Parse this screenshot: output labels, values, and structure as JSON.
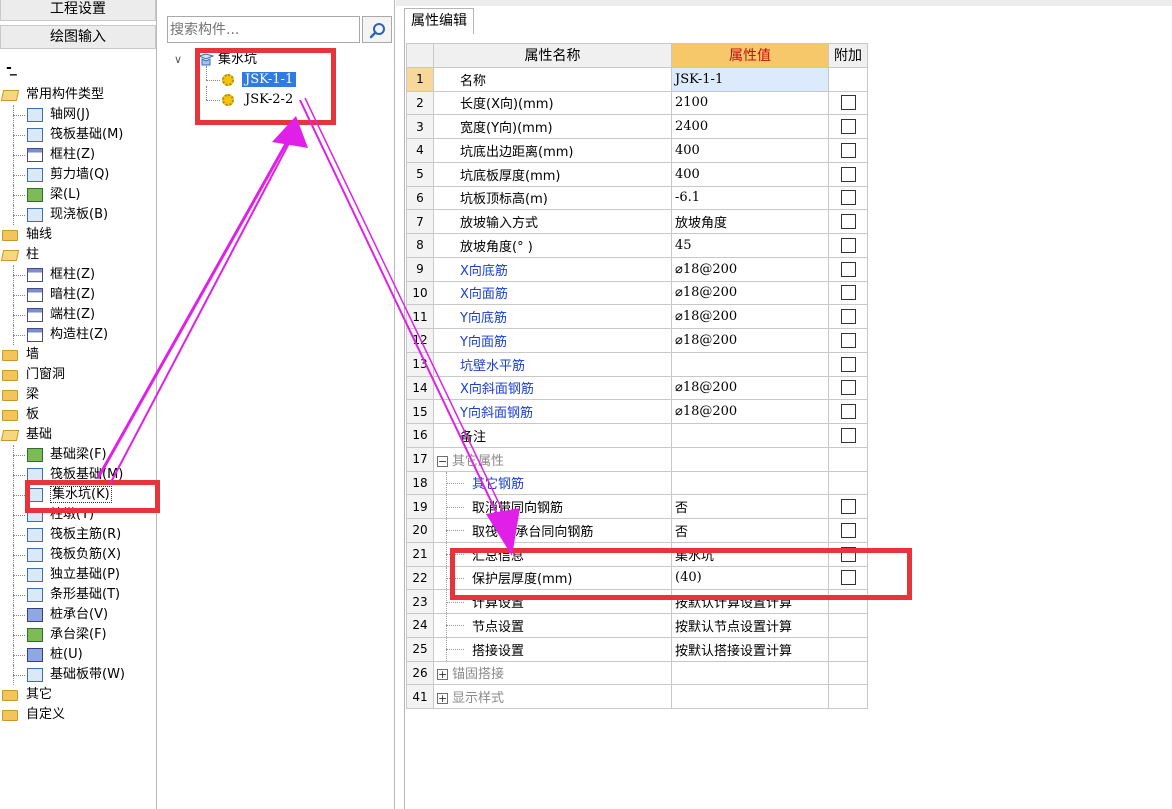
{
  "nav": {
    "tab_settings": "工程设置",
    "tab_drawing": "绘图输入",
    "collapse_symbol": "-",
    "tree": [
      {
        "label": "常用构件类型",
        "level": 0,
        "icon": "folder-open-icon"
      },
      {
        "label": "轴网(J)",
        "level": 1,
        "icon": "grid-axis-icon"
      },
      {
        "label": "筏板基础(M)",
        "level": 1,
        "icon": "raft-foundation-icon"
      },
      {
        "label": "框柱(Z)",
        "level": 1,
        "icon": "column-icon"
      },
      {
        "label": "剪力墙(Q)",
        "level": 1,
        "icon": "shear-wall-icon"
      },
      {
        "label": "梁(L)",
        "level": 1,
        "icon": "beam-icon"
      },
      {
        "label": "现浇板(B)",
        "level": 1,
        "icon": "slab-icon"
      },
      {
        "label": "轴线",
        "level": 0,
        "icon": "folder-icon"
      },
      {
        "label": "柱",
        "level": 0,
        "icon": "folder-open-icon"
      },
      {
        "label": "框柱(Z)",
        "level": 1,
        "icon": "column-icon"
      },
      {
        "label": "暗柱(Z)",
        "level": 1,
        "icon": "column-icon"
      },
      {
        "label": "端柱(Z)",
        "level": 1,
        "icon": "column-icon"
      },
      {
        "label": "构造柱(Z)",
        "level": 1,
        "icon": "constructional-column-icon"
      },
      {
        "label": "墙",
        "level": 0,
        "icon": "folder-icon"
      },
      {
        "label": "门窗洞",
        "level": 0,
        "icon": "folder-icon"
      },
      {
        "label": "梁",
        "level": 0,
        "icon": "folder-icon"
      },
      {
        "label": "板",
        "level": 0,
        "icon": "folder-icon"
      },
      {
        "label": "基础",
        "level": 0,
        "icon": "folder-open-icon"
      },
      {
        "label": "基础梁(F)",
        "level": 1,
        "icon": "foundation-beam-icon"
      },
      {
        "label": "筏板基础(M)",
        "level": 1,
        "icon": "raft-foundation-icon"
      },
      {
        "label": "集水坑(K)",
        "level": 1,
        "icon": "sump-pit-icon",
        "selected": true
      },
      {
        "label": "柱墩(Y)",
        "level": 1,
        "icon": "column-pier-icon"
      },
      {
        "label": "筏板主筋(R)",
        "level": 1,
        "icon": "raft-main-rebar-icon"
      },
      {
        "label": "筏板负筋(X)",
        "level": 1,
        "icon": "raft-negative-rebar-icon"
      },
      {
        "label": "独立基础(P)",
        "level": 1,
        "icon": "isolated-footing-icon"
      },
      {
        "label": "条形基础(T)",
        "level": 1,
        "icon": "strip-footing-icon"
      },
      {
        "label": "桩承台(V)",
        "level": 1,
        "icon": "pile-cap-icon"
      },
      {
        "label": "承台梁(F)",
        "level": 1,
        "icon": "cap-beam-icon"
      },
      {
        "label": "桩(U)",
        "level": 1,
        "icon": "pile-icon"
      },
      {
        "label": "基础板带(W)",
        "level": 1,
        "icon": "foundation-strip-icon"
      },
      {
        "label": "其它",
        "level": 0,
        "icon": "folder-icon"
      },
      {
        "label": "自定义",
        "level": 0,
        "icon": "folder-icon"
      }
    ]
  },
  "component_panel": {
    "search_placeholder": "搜索构件...",
    "root_label": "集水坑",
    "children": [
      {
        "label": "JSK-1-1",
        "selected": true
      },
      {
        "label": "JSK-2-2",
        "selected": false
      }
    ]
  },
  "properties": {
    "tab_label": "属性编辑",
    "headers": {
      "name": "属性名称",
      "value": "属性值",
      "extra": "附加"
    },
    "rows": [
      {
        "num": "1",
        "name": "名称",
        "value": "JSK-1-1",
        "style": "normal",
        "checkbox": false,
        "selected": true
      },
      {
        "num": "2",
        "name": "长度(X向)(mm)",
        "value": "2100",
        "style": "normal",
        "checkbox": true
      },
      {
        "num": "3",
        "name": "宽度(Y向)(mm)",
        "value": "2400",
        "style": "normal",
        "checkbox": true
      },
      {
        "num": "4",
        "name": "坑底出边距离(mm)",
        "value": "400",
        "style": "normal",
        "checkbox": true
      },
      {
        "num": "5",
        "name": "坑底板厚度(mm)",
        "value": "400",
        "style": "normal",
        "checkbox": true
      },
      {
        "num": "6",
        "name": "坑板顶标高(m)",
        "value": "-6.1",
        "style": "normal",
        "checkbox": true
      },
      {
        "num": "7",
        "name": "放坡输入方式",
        "value": "放坡角度",
        "style": "normal",
        "checkbox": true
      },
      {
        "num": "8",
        "name": "放坡角度(° )",
        "value": "45",
        "style": "normal",
        "checkbox": true
      },
      {
        "num": "9",
        "name": "X向底筋",
        "value": "⌀18@200",
        "style": "blue",
        "checkbox": true
      },
      {
        "num": "10",
        "name": "X向面筋",
        "value": "⌀18@200",
        "style": "blue",
        "checkbox": true
      },
      {
        "num": "11",
        "name": "Y向底筋",
        "value": "⌀18@200",
        "style": "blue",
        "checkbox": true
      },
      {
        "num": "12",
        "name": "Y向面筋",
        "value": "⌀18@200",
        "style": "blue",
        "checkbox": true
      },
      {
        "num": "13",
        "name": "坑壁水平筋",
        "value": "",
        "style": "blue",
        "checkbox": true
      },
      {
        "num": "14",
        "name": "X向斜面钢筋",
        "value": "⌀18@200",
        "style": "blue",
        "checkbox": true
      },
      {
        "num": "15",
        "name": "Y向斜面钢筋",
        "value": "⌀18@200",
        "style": "blue",
        "checkbox": true
      },
      {
        "num": "16",
        "name": "备注",
        "value": "",
        "style": "normal",
        "checkbox": true
      },
      {
        "num": "17",
        "name": "其它属性",
        "value": "",
        "style": "group",
        "checkbox": false,
        "toggle": "−"
      },
      {
        "num": "18",
        "name": "其它钢筋",
        "value": "",
        "style": "blue-sub",
        "checkbox": false
      },
      {
        "num": "19",
        "name": "取消带同向钢筋",
        "value": "否",
        "style": "sub",
        "checkbox": true
      },
      {
        "num": "20",
        "name": "取筏板/承台同向钢筋",
        "value": "否",
        "style": "sub",
        "checkbox": true
      },
      {
        "num": "21",
        "name": "汇总信息",
        "value": "集水坑",
        "style": "sub",
        "checkbox": true
      },
      {
        "num": "22",
        "name": "保护层厚度(mm)",
        "value": "(40)",
        "style": "sub",
        "checkbox": true
      },
      {
        "num": "23",
        "name": "计算设置",
        "value": "按默认计算设置计算",
        "style": "sub",
        "checkbox": false
      },
      {
        "num": "24",
        "name": "节点设置",
        "value": "按默认节点设置计算",
        "style": "sub",
        "checkbox": false
      },
      {
        "num": "25",
        "name": "搭接设置",
        "value": "按默认搭接设置计算",
        "style": "sub",
        "checkbox": false
      },
      {
        "num": "26",
        "name": "锚固搭接",
        "value": "",
        "style": "group",
        "checkbox": false,
        "toggle": "+"
      },
      {
        "num": "41",
        "name": "显示样式",
        "value": "",
        "style": "group",
        "checkbox": false,
        "toggle": "+"
      }
    ]
  },
  "annotation_colors": {
    "highlight_box": "#e8333b",
    "arrow": "#e020e8",
    "selection": "#2f7be3",
    "value_header": "#f7c86a"
  }
}
